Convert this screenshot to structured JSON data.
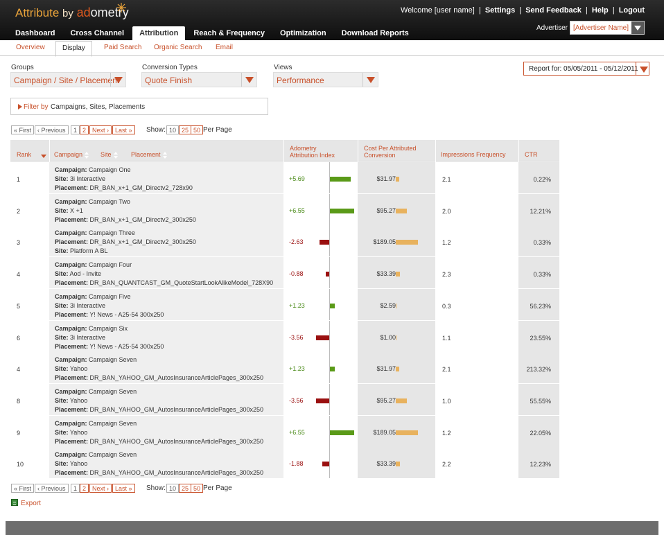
{
  "header": {
    "logo_prefix": "Attribute",
    "logo_by": "by",
    "logo_brand_a": "ad",
    "logo_brand_b": "ometry",
    "welcome": "Welcome [user name]",
    "settings": "Settings",
    "feedback": "Send Feedback",
    "help": "Help",
    "logout": "Logout",
    "separator": "|",
    "advertiser_label": "Advertiser",
    "advertiser_value": "[Advertiser Name]"
  },
  "main_nav": [
    "Dashboard",
    "Cross Channel",
    "Attribution",
    "Reach & Frequency",
    "Optimization",
    "Download Reports"
  ],
  "sub_nav": [
    "Overview",
    "Display",
    "Paid Search",
    "Organic Search",
    "Email"
  ],
  "filters": {
    "groups_label": "Groups",
    "groups_value": "Campaign / Site / Placement",
    "conversion_label": "Conversion Types",
    "conversion_value": "Quote Finish",
    "views_label": "Views",
    "views_value": "Performance",
    "report_for": "Report for:",
    "report_dates": "05/05/2011 - 05/12/2011",
    "filter_by": "Filter by",
    "filter_text": "Campaigns, Sites, Placements"
  },
  "pager": {
    "first": "« First",
    "prev": "‹ Previous",
    "p1": "1",
    "p2": "2",
    "next": "Next ›",
    "last": "Last »",
    "show": "Show:",
    "n10": "10",
    "n25": "25",
    "n50": "50",
    "per_page": "Per Page"
  },
  "table": {
    "headers": {
      "rank": "Rank",
      "campaign": "Campaign",
      "site": "Site",
      "placement": "Placement",
      "index_1": "Adometry",
      "index_2": "Attribution Index",
      "cost_1": "Cost Per Attributed",
      "cost_2": "Conversion",
      "impressions": "Impressions Frequency",
      "ctr": "CTR"
    },
    "rows": [
      {
        "rank": "1",
        "l1k": "Campaign:",
        "l1v": "Campaign One",
        "l2k": "Site:",
        "l2v": "3i Interactive",
        "l3k": "Placement:",
        "l3v": "DR_BAN_x+1_GM_Directv2_728x90",
        "index": "+5.69",
        "index_val": 5.69,
        "cost": "$31.97",
        "cost_val": 31.97,
        "imp": "2.1",
        "ctr": "0.22%"
      },
      {
        "rank": "2",
        "l1k": "Campaign:",
        "l1v": "Campaign Two",
        "l2k": "Site:",
        "l2v": "X +1",
        "l3k": "Placement:",
        "l3v": "DR_BAN_x+1_GM_Directv2_300x250",
        "index": "+6.55",
        "index_val": 6.55,
        "cost": "$95.27",
        "cost_val": 95.27,
        "imp": "2.0",
        "ctr": "12.21%"
      },
      {
        "rank": "3",
        "l1k": "Campaign:",
        "l1v": "Campaign Three",
        "l2k": "Placement:",
        "l2v": "DR_BAN_x+1_GM_Directv2_300x250",
        "l3k": "Site:",
        "l3v": "Platform A BL",
        "index": "-2.63",
        "index_val": -2.63,
        "cost": "$189.05",
        "cost_val": 189.05,
        "imp": "1.2",
        "ctr": "0.33%"
      },
      {
        "rank": "4",
        "l1k": "Campaign:",
        "l1v": "Campaign Four",
        "l2k": "Site:",
        "l2v": "Aod - Invite",
        "l3k": "Placement:",
        "l3v": "DR_BAN_QUANTCAST_GM_QuoteStartLookAlikeModel_728X90",
        "index": "-0.88",
        "index_val": -0.88,
        "cost": "$33.39",
        "cost_val": 33.39,
        "imp": "2.3",
        "ctr": "0.33%"
      },
      {
        "rank": "5",
        "l1k": "Campaign:",
        "l1v": "Campaign Five",
        "l2k": "Site:",
        "l2v": "3i Interactive",
        "l3k": "Placement:",
        "l3v": "Y! News - A25-54 300x250",
        "index": "+1.23",
        "index_val": 1.23,
        "cost": "$2.59",
        "cost_val": 2.59,
        "imp": "0.3",
        "ctr": "56.23%"
      },
      {
        "rank": "6",
        "l1k": "Campaign:",
        "l1v": "Campaign Six",
        "l2k": "Site:",
        "l2v": "3i Interactive",
        "l3k": "Placement:",
        "l3v": "Y! News - A25-54 300x250",
        "index": "-3.56",
        "index_val": -3.56,
        "cost": "$1.00",
        "cost_val": 1.0,
        "imp": "1.1",
        "ctr": "23.55%"
      },
      {
        "rank": "4",
        "l1k": "Campaign:",
        "l1v": "Campaign Seven",
        "l2k": "Site:",
        "l2v": "Yahoo",
        "l3k": "Placement:",
        "l3v": "DR_BAN_YAHOO_GM_AutosInsuranceArticlePages_300x250",
        "index": "+1.23",
        "index_val": 1.23,
        "cost": "$31.97",
        "cost_val": 31.97,
        "imp": "2.1",
        "ctr": "213.32%"
      },
      {
        "rank": "8",
        "l1k": "Campaign:",
        "l1v": "Campaign Seven",
        "l2k": "Site:",
        "l2v": "Yahoo",
        "l3k": "Placement:",
        "l3v": "DR_BAN_YAHOO_GM_AutosInsuranceArticlePages_300x250",
        "index": "-3.56",
        "index_val": -3.56,
        "cost": "$95.27",
        "cost_val": 95.27,
        "imp": "1.0",
        "ctr": "55.55%"
      },
      {
        "rank": "9",
        "l1k": "Campaign:",
        "l1v": "Campaign Seven",
        "l2k": "Site:",
        "l2v": "Yahoo",
        "l3k": "Placement:",
        "l3v": "DR_BAN_YAHOO_GM_AutosInsuranceArticlePages_300x250",
        "index": "+6.55",
        "index_val": 6.55,
        "cost": "$189.05",
        "cost_val": 189.05,
        "imp": "1.2",
        "ctr": "22.05%"
      },
      {
        "rank": "10",
        "l1k": "Campaign:",
        "l1v": "Campaign Seven",
        "l2k": "Site:",
        "l2v": "Yahoo",
        "l3k": "Placement:",
        "l3v": "DR_BAN_YAHOO_GM_AutosInsuranceArticlePages_300x250",
        "index": "-1.88",
        "index_val": -1.88,
        "cost": "$33.39",
        "cost_val": 33.39,
        "imp": "2.2",
        "ctr": "12.23%"
      }
    ]
  },
  "export": "Export",
  "colors": {
    "accent": "#c8502a",
    "positive_bar": "#5a9a18",
    "negative_bar": "#9a1010",
    "cost_bar": "#e8b25e",
    "header_bg": "#1a1a1a"
  }
}
